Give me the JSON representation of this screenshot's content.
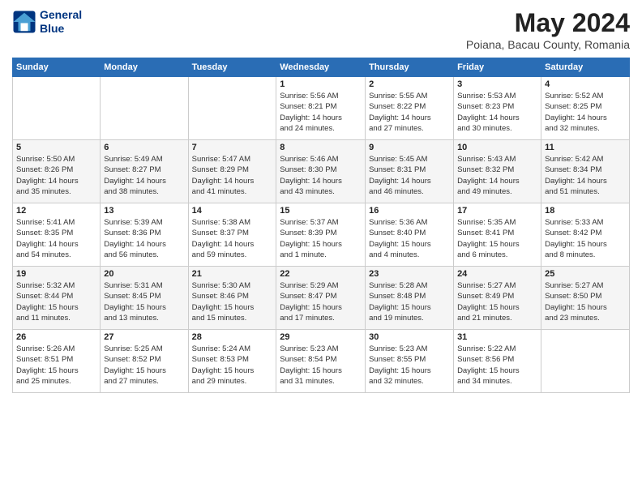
{
  "logo": {
    "line1": "General",
    "line2": "Blue"
  },
  "title": "May 2024",
  "subtitle": "Poiana, Bacau County, Romania",
  "header_days": [
    "Sunday",
    "Monday",
    "Tuesday",
    "Wednesday",
    "Thursday",
    "Friday",
    "Saturday"
  ],
  "weeks": [
    [
      {
        "day": "",
        "info": ""
      },
      {
        "day": "",
        "info": ""
      },
      {
        "day": "",
        "info": ""
      },
      {
        "day": "1",
        "info": "Sunrise: 5:56 AM\nSunset: 8:21 PM\nDaylight: 14 hours\nand 24 minutes."
      },
      {
        "day": "2",
        "info": "Sunrise: 5:55 AM\nSunset: 8:22 PM\nDaylight: 14 hours\nand 27 minutes."
      },
      {
        "day": "3",
        "info": "Sunrise: 5:53 AM\nSunset: 8:23 PM\nDaylight: 14 hours\nand 30 minutes."
      },
      {
        "day": "4",
        "info": "Sunrise: 5:52 AM\nSunset: 8:25 PM\nDaylight: 14 hours\nand 32 minutes."
      }
    ],
    [
      {
        "day": "5",
        "info": "Sunrise: 5:50 AM\nSunset: 8:26 PM\nDaylight: 14 hours\nand 35 minutes."
      },
      {
        "day": "6",
        "info": "Sunrise: 5:49 AM\nSunset: 8:27 PM\nDaylight: 14 hours\nand 38 minutes."
      },
      {
        "day": "7",
        "info": "Sunrise: 5:47 AM\nSunset: 8:29 PM\nDaylight: 14 hours\nand 41 minutes."
      },
      {
        "day": "8",
        "info": "Sunrise: 5:46 AM\nSunset: 8:30 PM\nDaylight: 14 hours\nand 43 minutes."
      },
      {
        "day": "9",
        "info": "Sunrise: 5:45 AM\nSunset: 8:31 PM\nDaylight: 14 hours\nand 46 minutes."
      },
      {
        "day": "10",
        "info": "Sunrise: 5:43 AM\nSunset: 8:32 PM\nDaylight: 14 hours\nand 49 minutes."
      },
      {
        "day": "11",
        "info": "Sunrise: 5:42 AM\nSunset: 8:34 PM\nDaylight: 14 hours\nand 51 minutes."
      }
    ],
    [
      {
        "day": "12",
        "info": "Sunrise: 5:41 AM\nSunset: 8:35 PM\nDaylight: 14 hours\nand 54 minutes."
      },
      {
        "day": "13",
        "info": "Sunrise: 5:39 AM\nSunset: 8:36 PM\nDaylight: 14 hours\nand 56 minutes."
      },
      {
        "day": "14",
        "info": "Sunrise: 5:38 AM\nSunset: 8:37 PM\nDaylight: 14 hours\nand 59 minutes."
      },
      {
        "day": "15",
        "info": "Sunrise: 5:37 AM\nSunset: 8:39 PM\nDaylight: 15 hours\nand 1 minute."
      },
      {
        "day": "16",
        "info": "Sunrise: 5:36 AM\nSunset: 8:40 PM\nDaylight: 15 hours\nand 4 minutes."
      },
      {
        "day": "17",
        "info": "Sunrise: 5:35 AM\nSunset: 8:41 PM\nDaylight: 15 hours\nand 6 minutes."
      },
      {
        "day": "18",
        "info": "Sunrise: 5:33 AM\nSunset: 8:42 PM\nDaylight: 15 hours\nand 8 minutes."
      }
    ],
    [
      {
        "day": "19",
        "info": "Sunrise: 5:32 AM\nSunset: 8:44 PM\nDaylight: 15 hours\nand 11 minutes."
      },
      {
        "day": "20",
        "info": "Sunrise: 5:31 AM\nSunset: 8:45 PM\nDaylight: 15 hours\nand 13 minutes."
      },
      {
        "day": "21",
        "info": "Sunrise: 5:30 AM\nSunset: 8:46 PM\nDaylight: 15 hours\nand 15 minutes."
      },
      {
        "day": "22",
        "info": "Sunrise: 5:29 AM\nSunset: 8:47 PM\nDaylight: 15 hours\nand 17 minutes."
      },
      {
        "day": "23",
        "info": "Sunrise: 5:28 AM\nSunset: 8:48 PM\nDaylight: 15 hours\nand 19 minutes."
      },
      {
        "day": "24",
        "info": "Sunrise: 5:27 AM\nSunset: 8:49 PM\nDaylight: 15 hours\nand 21 minutes."
      },
      {
        "day": "25",
        "info": "Sunrise: 5:27 AM\nSunset: 8:50 PM\nDaylight: 15 hours\nand 23 minutes."
      }
    ],
    [
      {
        "day": "26",
        "info": "Sunrise: 5:26 AM\nSunset: 8:51 PM\nDaylight: 15 hours\nand 25 minutes."
      },
      {
        "day": "27",
        "info": "Sunrise: 5:25 AM\nSunset: 8:52 PM\nDaylight: 15 hours\nand 27 minutes."
      },
      {
        "day": "28",
        "info": "Sunrise: 5:24 AM\nSunset: 8:53 PM\nDaylight: 15 hours\nand 29 minutes."
      },
      {
        "day": "29",
        "info": "Sunrise: 5:23 AM\nSunset: 8:54 PM\nDaylight: 15 hours\nand 31 minutes."
      },
      {
        "day": "30",
        "info": "Sunrise: 5:23 AM\nSunset: 8:55 PM\nDaylight: 15 hours\nand 32 minutes."
      },
      {
        "day": "31",
        "info": "Sunrise: 5:22 AM\nSunset: 8:56 PM\nDaylight: 15 hours\nand 34 minutes."
      },
      {
        "day": "",
        "info": ""
      }
    ]
  ]
}
